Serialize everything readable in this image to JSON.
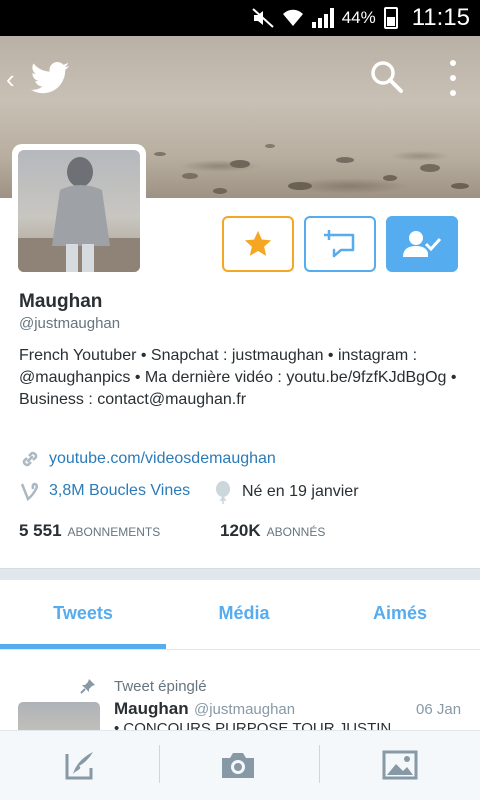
{
  "status_bar": {
    "battery": "44%",
    "time": "11:15"
  },
  "profile": {
    "name": "Maughan",
    "handle": "@justmaughan",
    "bio": "French Youtuber • Snapchat : justmaughan • instagram : @maughanpics • Ma dernière vidéo : youtu.be/9fzfKJdBgOg • Business : contact@maughan.fr",
    "website": "youtube.com/videosdemaughan",
    "vine": "3,8M Boucles Vines",
    "birthday": "Né en 19 janvier",
    "following_count": "5 551",
    "following_label": "ABONNEMENTS",
    "followers_count": "120K",
    "followers_label": "ABONNÉS"
  },
  "tabs": [
    {
      "label": "Tweets",
      "active": true
    },
    {
      "label": "Média",
      "active": false
    },
    {
      "label": "Aimés",
      "active": false
    }
  ],
  "pinned_tweet": {
    "pinned_label": "Tweet épinglé",
    "author": "Maughan",
    "handle": "@justmaughan",
    "date": "06 Jan",
    "text": "• CONCOURS PURPOSE TOUR JUSTIN"
  },
  "colors": {
    "accent": "#55acee",
    "favorite": "#f5a623",
    "link": "#2b7bb9"
  },
  "icons": {
    "back": "chevron-left-icon",
    "logo": "twitter-bird-icon",
    "search": "search-icon",
    "more": "more-vertical-icon",
    "favorite": "star-icon",
    "message": "direct-message-icon",
    "follow": "following-check-icon",
    "compose": "compose-tweet-icon",
    "camera": "camera-icon",
    "gallery": "image-gallery-icon"
  }
}
